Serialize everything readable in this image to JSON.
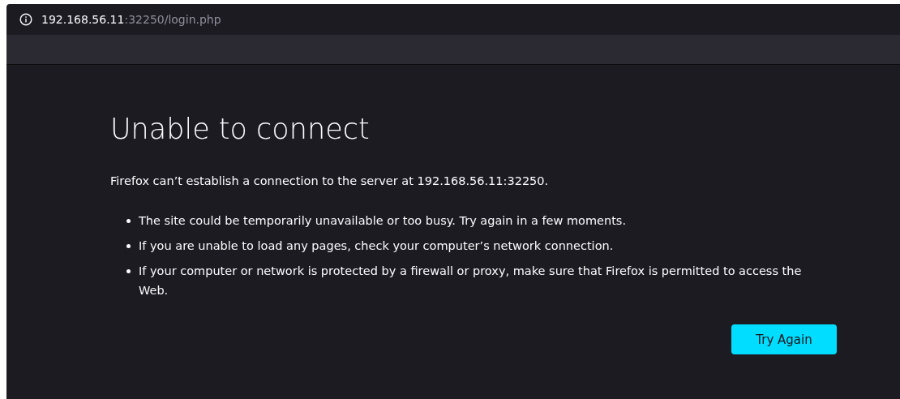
{
  "address_bar": {
    "host": "192.168.56.11",
    "rest": ":32250/login.php"
  },
  "error": {
    "title": "Unable to connect",
    "message": "Firefox can’t establish a connection to the server at 192.168.56.11:32250.",
    "bullets": [
      "The site could be temporarily unavailable or too busy. Try again in a few moments.",
      "If you are unable to load any pages, check your computer’s network connection.",
      "If your computer or network is protected by a firewall or proxy, make sure that Firefox is permitted to access the Web."
    ],
    "button": "Try Again"
  }
}
